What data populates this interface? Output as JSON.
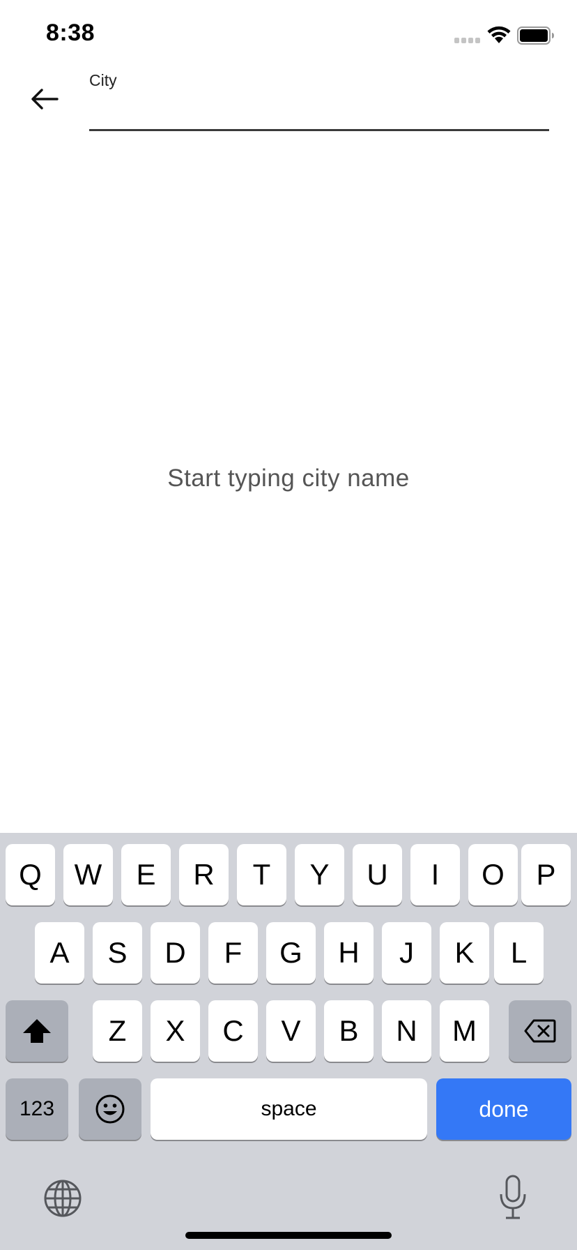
{
  "status_bar": {
    "time": "8:38"
  },
  "header": {
    "input_label": "City",
    "input_value": "",
    "back_icon": "arrow-left-icon"
  },
  "empty_state": {
    "message": "Start typing city name"
  },
  "keyboard": {
    "row1": [
      "Q",
      "W",
      "E",
      "R",
      "T",
      "Y",
      "U",
      "I",
      "O",
      "P"
    ],
    "row2": [
      "A",
      "S",
      "D",
      "F",
      "G",
      "H",
      "J",
      "K",
      "L"
    ],
    "row3": [
      "Z",
      "X",
      "C",
      "V",
      "B",
      "N",
      "M"
    ],
    "numbers_label": "123",
    "space_label": "space",
    "done_label": "done",
    "done_color": "#3478f6",
    "icons": {
      "shift": "shift-icon",
      "delete": "delete-icon",
      "emoji": "emoji-icon",
      "globe": "globe-icon",
      "mic": "microphone-icon"
    }
  }
}
